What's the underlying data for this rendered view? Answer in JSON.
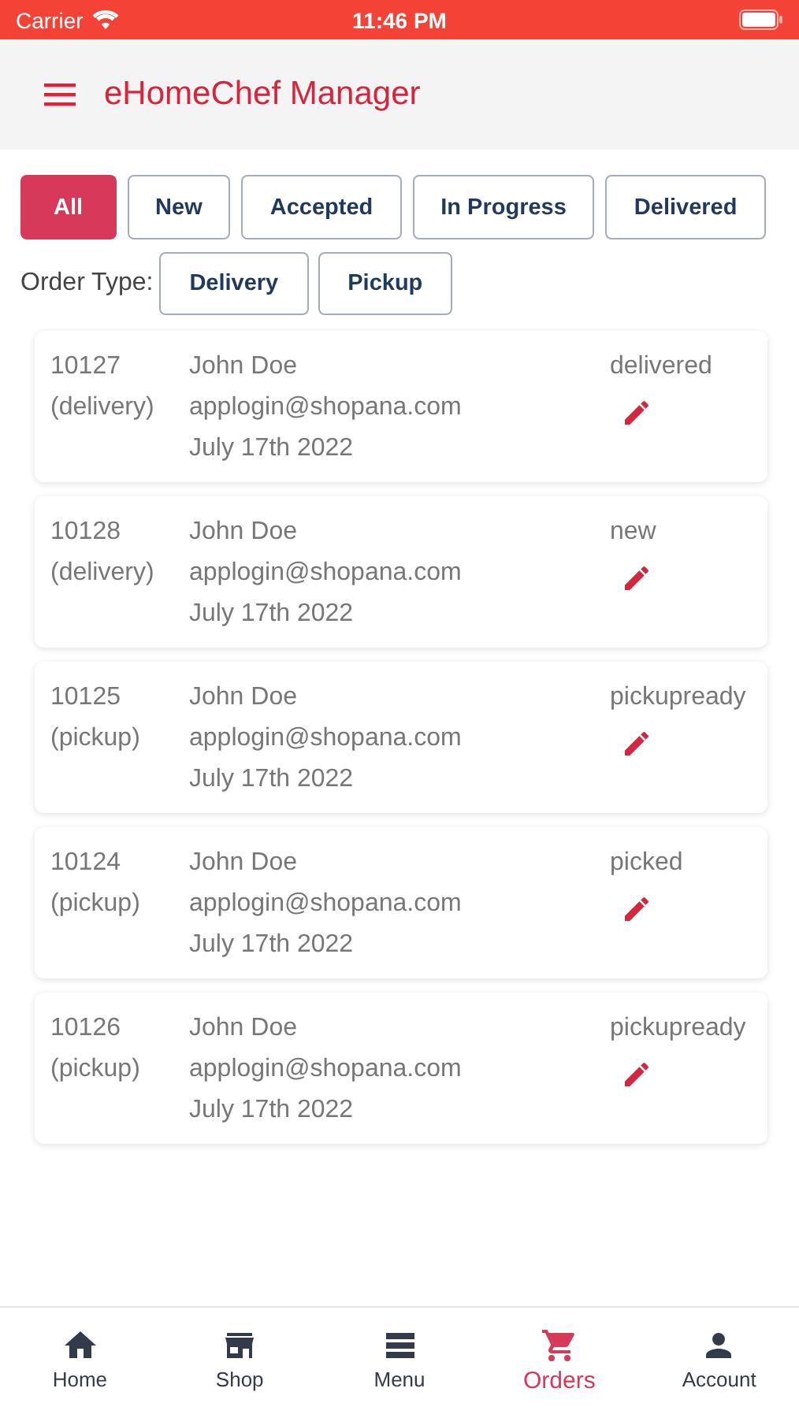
{
  "status_bar": {
    "carrier": "Carrier",
    "time": "11:46 PM"
  },
  "header": {
    "title": "eHomeChef Manager"
  },
  "status_filters": [
    {
      "label": "All",
      "selected": true
    },
    {
      "label": "New",
      "selected": false
    },
    {
      "label": "Accepted",
      "selected": false
    },
    {
      "label": "In Progress",
      "selected": false
    },
    {
      "label": "Delivered",
      "selected": false
    }
  ],
  "order_type": {
    "label": "Order Type:",
    "options": [
      {
        "label": "Delivery",
        "selected": false
      },
      {
        "label": "Pickup",
        "selected": false
      }
    ]
  },
  "orders": [
    {
      "id": "10127",
      "type": "(delivery)",
      "name": "John Doe",
      "email": "applogin@shopana.com",
      "date": "July 17th 2022",
      "status": "delivered"
    },
    {
      "id": "10128",
      "type": "(delivery)",
      "name": "John Doe",
      "email": "applogin@shopana.com",
      "date": "July 17th 2022",
      "status": "new"
    },
    {
      "id": "10125",
      "type": "(pickup)",
      "name": "John Doe",
      "email": "applogin@shopana.com",
      "date": "July 17th 2022",
      "status": "pickupready"
    },
    {
      "id": "10124",
      "type": "(pickup)",
      "name": "John Doe",
      "email": "applogin@shopana.com",
      "date": "July 17th 2022",
      "status": "picked"
    },
    {
      "id": "10126",
      "type": "(pickup)",
      "name": "John Doe",
      "email": "applogin@shopana.com",
      "date": "July 17th 2022",
      "status": "pickupready"
    }
  ],
  "bottom_nav": [
    {
      "label": "Home",
      "selected": false
    },
    {
      "label": "Shop",
      "selected": false
    },
    {
      "label": "Menu",
      "selected": false
    },
    {
      "label": "Orders",
      "selected": true
    },
    {
      "label": "Account",
      "selected": false
    }
  ]
}
